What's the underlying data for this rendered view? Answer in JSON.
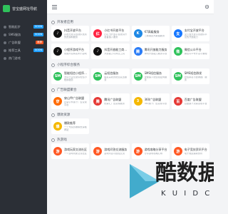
{
  "app": {
    "brand": "曾宝盛网址导航"
  },
  "sidebar": {
    "items": [
      {
        "label": "智能起步",
        "badge": "SOON",
        "badge_color": "#1e9fff"
      },
      {
        "label": "SMS服务",
        "badge": "SOON",
        "badge_color": "#1e9fff"
      },
      {
        "label": "广告联盟",
        "badge": "推荐",
        "badge_color": "#ff5722"
      },
      {
        "label": "推荐工具",
        "badge": "SOON",
        "badge_color": "#1e9fff"
      },
      {
        "label": "热门游戏",
        "badge": "",
        "badge_color": "#1e9fff"
      }
    ]
  },
  "sections": [
    {
      "title": "开发者应用",
      "cards": [
        {
          "name": "抖音开放平台",
          "desc": "抖音开放平台提供优质的资源和服务",
          "color": "#111111",
          "glyph": "♪"
        },
        {
          "name": "小红书开放平台",
          "desc": "小红书开放平台提供开发者接入服务",
          "color": "#ff2442",
          "glyph": "红"
        },
        {
          "name": "K7高级服务",
          "desc": "三频推送大数据服务",
          "color": "#1e88e5",
          "glyph": "K"
        },
        {
          "name": "支付宝开放平台",
          "desc": "支付宝开放平台提供丰富的开放能力",
          "color": "#1677ff",
          "glyph": "支"
        },
        {
          "name": "小程序游戏平台",
          "desc": "快速开发和发布小游戏",
          "color": "#111111",
          "glyph": "♪"
        },
        {
          "name": "抖音开放能工商平台",
          "desc": "开放能力与商业工具",
          "color": "#111111",
          "glyph": "♪"
        },
        {
          "name": "腾讯开放能力服务",
          "desc": "腾讯开放能力服务平台",
          "color": "#2b7cf6",
          "glyph": "腾"
        },
        {
          "name": "微信公众平台",
          "desc": "微信公众号开发与管理",
          "color": "#2fc25b",
          "glyph": "微"
        }
      ]
    },
    {
      "title": "小程序综合服务",
      "cards": [
        {
          "name": "智能短信小程序服务",
          "desc": "为中小企业提供短信小程序服务",
          "color": "#2fc25b",
          "glyph": "SM"
        },
        {
          "name": "云短信服务",
          "desc": "稳定高效的短信发送服务",
          "color": "#2fc25b",
          "glyph": "SM"
        },
        {
          "name": "SMS短信服务",
          "desc": "快速接入短信验证码服务",
          "color": "#2fc25b",
          "glyph": "SM"
        },
        {
          "name": "SMS短信群发",
          "desc": "短信群发与营销推广服务",
          "color": "#2fc25b",
          "glyph": "SM"
        }
      ]
    },
    {
      "title": "广告联盟聚合",
      "cards": [
        {
          "name": "穿山甲广告联盟",
          "desc": "巨量引擎旗下广告变现平台",
          "color": "#ff6a00",
          "glyph": "穿"
        },
        {
          "name": "腾讯广告联盟",
          "desc": "优量汇广告变现服务",
          "color": "#e53935",
          "glyph": "腾"
        },
        {
          "name": "360广告联盟",
          "desc": "360旗下广告变现平台",
          "color": "#f5b800",
          "glyph": "3"
        },
        {
          "name": "百度广告联盟",
          "desc": "百度旗下流量变现平台",
          "color": "#e53935",
          "glyph": "百"
        }
      ]
    },
    {
      "title": "爆款资源",
      "cards": [
        {
          "name": "爆款推荐",
          "desc": "一个专属的爆款资源推荐站",
          "color": "#f5b800",
          "glyph": "爆"
        },
        {
          "name": "",
          "desc": "",
          "color": "#ffffff",
          "glyph": ""
        },
        {
          "name": "",
          "desc": "",
          "color": "#ffffff",
          "glyph": ""
        },
        {
          "name": "",
          "desc": "",
          "color": "#ffffff",
          "glyph": ""
        }
      ]
    },
    {
      "title": "热游戏",
      "cards": [
        {
          "name": "游戏玩家交流社区",
          "desc": "一个游戏玩家交流社区",
          "color": "#ff5722",
          "glyph": "游"
        },
        {
          "name": "游戏问答交流服务",
          "desc": "游戏问答与经验交流",
          "color": "#ff5722",
          "glyph": "游"
        },
        {
          "name": "游戏攻略分享平台",
          "desc": "分享游戏攻略心得",
          "color": "#ff5722",
          "glyph": "游"
        },
        {
          "name": "电子竞技资讯平台",
          "desc": "电子竞技最新资讯",
          "color": "#ff5722",
          "glyph": "游"
        }
      ]
    }
  ],
  "watermark": {
    "text": "酷数据",
    "sub": "K U I D C"
  },
  "icons": {
    "menu": "menu-icon",
    "settings": "settings-icon"
  }
}
